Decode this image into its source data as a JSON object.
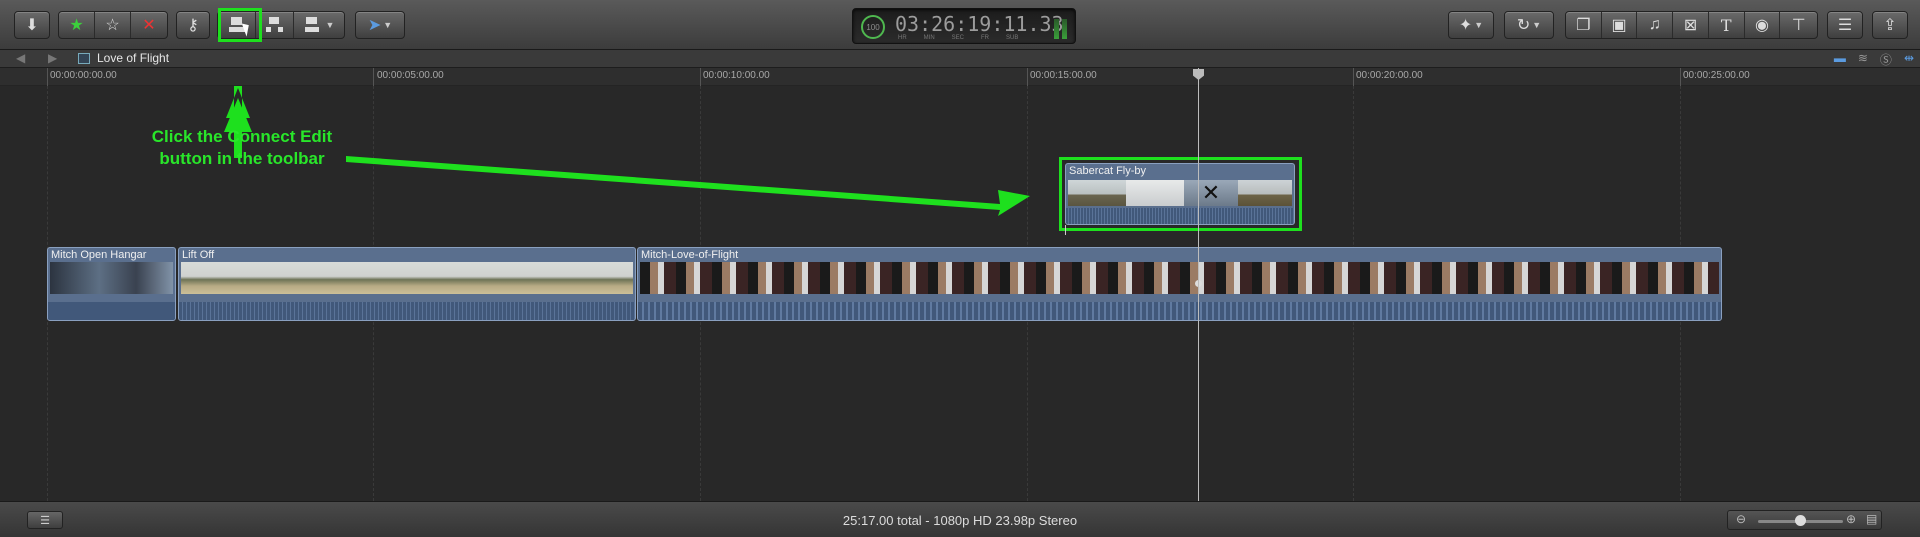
{
  "toolbar": {
    "import_icon": "download-arrow",
    "rating": {
      "favorite": "★",
      "unrate": "☆",
      "reject": "✕"
    },
    "keyword_icon": "key",
    "edit_buttons": [
      "connect-edit",
      "insert-edit",
      "append-edit"
    ],
    "tool_select_icon": "arrow-pointer",
    "timecode": {
      "percent": "100",
      "value": "03:26:19:11.33",
      "units": [
        "HR",
        "MIN",
        "SEC",
        "FR",
        "SUB"
      ]
    },
    "right_icons": [
      "magic-wand",
      "retime",
      "browser",
      "photo",
      "music",
      "transition",
      "title",
      "generator",
      "themes",
      "inspector",
      "share"
    ]
  },
  "pathbar": {
    "project_title": "Love of Flight",
    "view_icons": [
      "clip-appearance",
      "waveform",
      "solo",
      "snapping"
    ]
  },
  "ruler": {
    "ticks": [
      "00:00:00:00.00",
      "00:00:05:00.00",
      "00:00:10:00.00",
      "00:00:15:00.00",
      "00:00:20:00.00",
      "00:00:25:00.00"
    ]
  },
  "clips": {
    "connected": {
      "name": "Sabercat Fly-by"
    },
    "primary": [
      {
        "name": "Mitch Open Hangar"
      },
      {
        "name": "Lift Off"
      },
      {
        "name": "Mitch-Love-of-Flight"
      }
    ]
  },
  "annotation": {
    "text": "Click the Connect Edit button in the toolbar",
    "color": "#29e62a"
  },
  "status_bar": {
    "summary": "25:17.00 total - 1080p HD 23.98p Stereo"
  },
  "colors": {
    "highlight": "#1ee01e",
    "clip_blue": "#5a6f8e",
    "tool_blue": "#5b9be0"
  }
}
